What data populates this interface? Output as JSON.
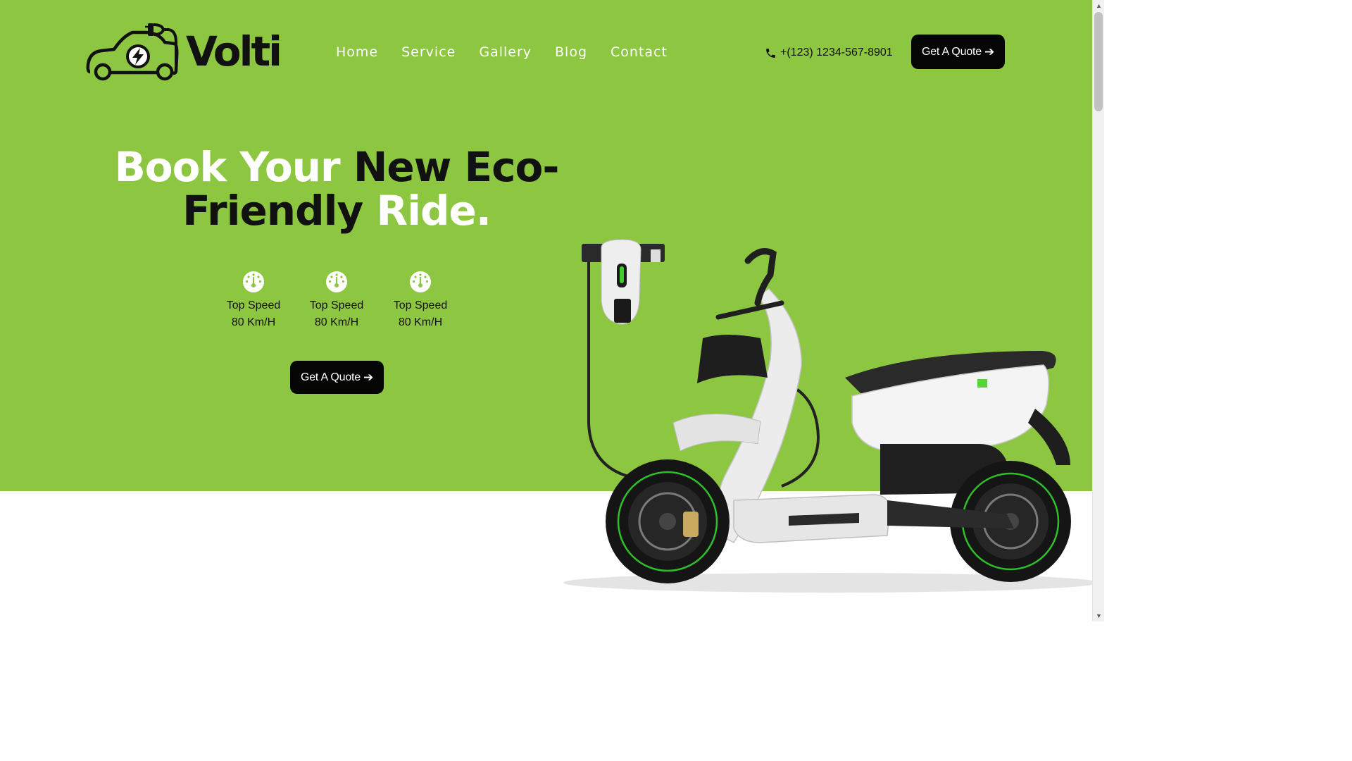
{
  "header": {
    "logo_text": "Volti",
    "nav": [
      "Home",
      "Service",
      "Gallery",
      "Blog",
      "Contact"
    ],
    "phone": "+(123) 1234-567-8901",
    "quote_label": "Get A Quote"
  },
  "hero": {
    "headline": {
      "part1": "Book Your ",
      "part2": "New Eco-",
      "part3": "Friendly",
      "part4": " Ride."
    },
    "specs": [
      {
        "label": "Top Speed",
        "value": "80 Km/H"
      },
      {
        "label": "Top Speed",
        "value": "80 Km/H"
      },
      {
        "label": "Top Speed",
        "value": "80 Km/H"
      }
    ],
    "quote_label": "Get A Quote"
  },
  "icons": {
    "logo": "electric-car-logo-icon",
    "phone": "phone-icon",
    "arrow": "arrow-right-icon",
    "spec": "speedometer-icon"
  },
  "colors": {
    "hero_green": "#8dc641",
    "button_black": "#050505",
    "text_dark": "#111111",
    "text_light": "#ffffff"
  }
}
